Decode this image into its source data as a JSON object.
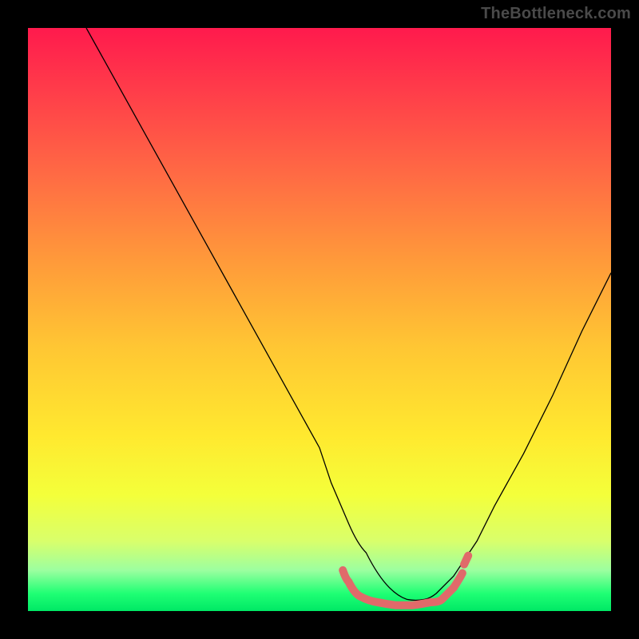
{
  "attribution": "TheBottleneck.com",
  "chart_data": {
    "type": "line",
    "title": "",
    "xlabel": "",
    "ylabel": "",
    "xlim": [
      0,
      100
    ],
    "ylim": [
      0,
      100
    ],
    "series": [
      {
        "name": "bottleneck-curve",
        "x": [
          10,
          15,
          20,
          25,
          30,
          35,
          40,
          45,
          50,
          52,
          55,
          58,
          62,
          65,
          68,
          70,
          73,
          77,
          80,
          85,
          90,
          95,
          100
        ],
        "values": [
          100,
          91,
          82,
          73,
          64,
          55,
          46,
          37,
          28,
          22,
          15,
          10,
          4,
          2,
          2,
          2,
          3,
          6,
          10,
          18,
          27,
          37,
          48
        ]
      },
      {
        "name": "optimal-range-marker",
        "x": [
          54,
          55,
          57,
          60,
          63,
          66,
          69,
          72,
          74,
          75
        ],
        "values": [
          7,
          5,
          3,
          1.5,
          1,
          1,
          1.5,
          2.5,
          5,
          7
        ]
      }
    ],
    "colors": {
      "curve": "#000000",
      "marker": "#e06a6a",
      "gradient_top": "#ff1a4d",
      "gradient_bottom": "#00e865"
    }
  }
}
